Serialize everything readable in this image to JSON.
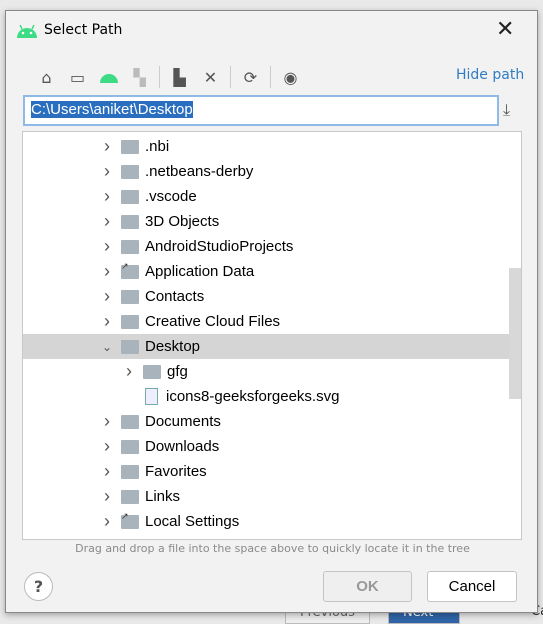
{
  "background": {
    "previous": "Previous",
    "next": "Next",
    "cancel": "Can"
  },
  "dialog": {
    "title": "Select Path",
    "close_icon": "close-icon",
    "hide_path": "Hide path",
    "path": "C:\\Users\\aniket\\Desktop",
    "toolbar": [
      "home-icon",
      "desktop-icon",
      "android-project-icon",
      "module-icon",
      "new-folder-icon",
      "delete-icon",
      "refresh-icon",
      "show-hidden-icon"
    ],
    "tree": [
      {
        "label": ".nbi",
        "expand": "collapsed",
        "type": "folder"
      },
      {
        "label": ".netbeans-derby",
        "expand": "collapsed",
        "type": "folder"
      },
      {
        "label": ".vscode",
        "expand": "collapsed",
        "type": "folder"
      },
      {
        "label": "3D Objects",
        "expand": "collapsed",
        "type": "folder"
      },
      {
        "label": "AndroidStudioProjects",
        "expand": "collapsed",
        "type": "folder"
      },
      {
        "label": "Application Data",
        "expand": "collapsed",
        "type": "link"
      },
      {
        "label": "Contacts",
        "expand": "collapsed",
        "type": "folder"
      },
      {
        "label": "Creative Cloud Files",
        "expand": "collapsed",
        "type": "folder"
      },
      {
        "label": "Desktop",
        "expand": "expanded",
        "type": "folder",
        "selected": true
      },
      {
        "label": "gfg",
        "expand": "collapsed",
        "type": "folder",
        "level": 2
      },
      {
        "label": "icons8-geeksforgeeks.svg",
        "expand": "none",
        "type": "file",
        "level": 2
      },
      {
        "label": "Documents",
        "expand": "collapsed",
        "type": "folder"
      },
      {
        "label": "Downloads",
        "expand": "collapsed",
        "type": "folder"
      },
      {
        "label": "Favorites",
        "expand": "collapsed",
        "type": "folder"
      },
      {
        "label": "Links",
        "expand": "collapsed",
        "type": "folder"
      },
      {
        "label": "Local Settings",
        "expand": "collapsed",
        "type": "link"
      }
    ],
    "hint": "Drag and drop a file into the space above to quickly locate it in the tree",
    "ok": "OK",
    "cancel": "Cancel",
    "help": "?"
  }
}
